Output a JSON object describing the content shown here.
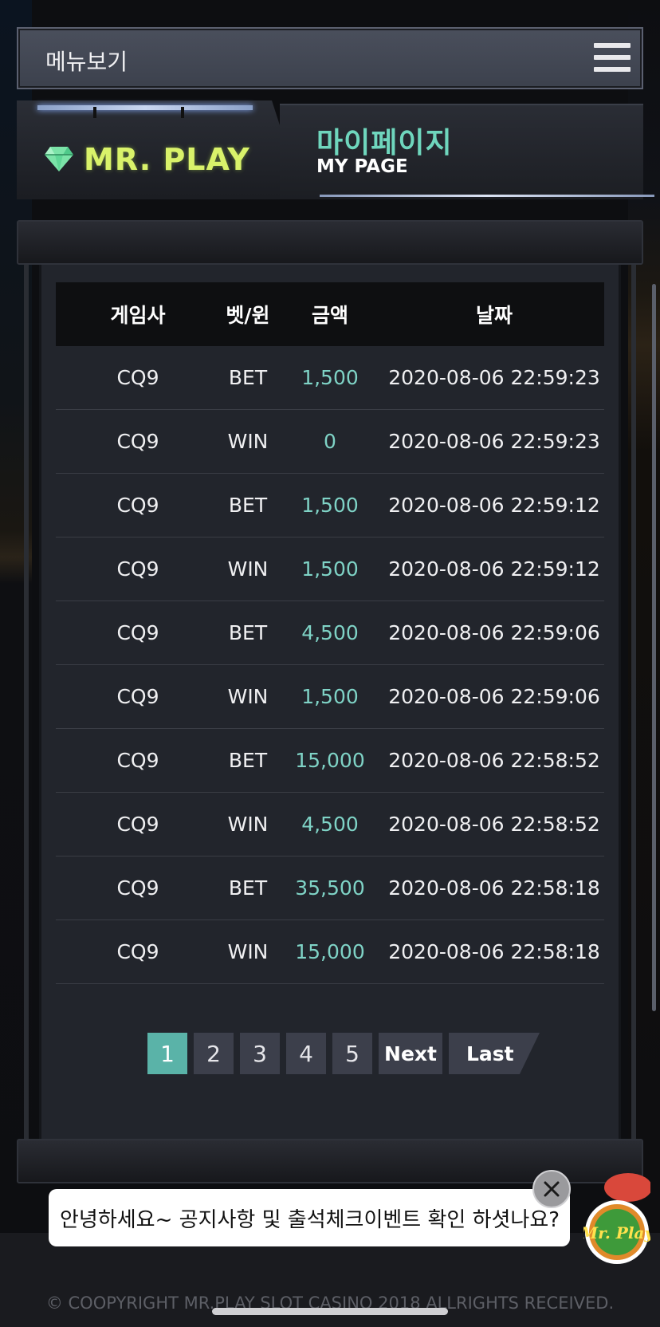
{
  "menu": {
    "label": "메뉴보기"
  },
  "banner": {
    "brand": "MR. PLAY",
    "page_title_kr": "마이페이지",
    "page_title_en": "MY PAGE"
  },
  "table": {
    "headers": [
      "게임사",
      "벳/윈",
      "금액",
      "날짜"
    ],
    "rows": [
      {
        "provider": "CQ9",
        "type": "BET",
        "amount": "1,500",
        "date": "2020-08-06 22:59:23"
      },
      {
        "provider": "CQ9",
        "type": "WIN",
        "amount": "0",
        "date": "2020-08-06 22:59:23"
      },
      {
        "provider": "CQ9",
        "type": "BET",
        "amount": "1,500",
        "date": "2020-08-06 22:59:12"
      },
      {
        "provider": "CQ9",
        "type": "WIN",
        "amount": "1,500",
        "date": "2020-08-06 22:59:12"
      },
      {
        "provider": "CQ9",
        "type": "BET",
        "amount": "4,500",
        "date": "2020-08-06 22:59:06"
      },
      {
        "provider": "CQ9",
        "type": "WIN",
        "amount": "1,500",
        "date": "2020-08-06 22:59:06"
      },
      {
        "provider": "CQ9",
        "type": "BET",
        "amount": "15,000",
        "date": "2020-08-06 22:58:52"
      },
      {
        "provider": "CQ9",
        "type": "WIN",
        "amount": "4,500",
        "date": "2020-08-06 22:58:52"
      },
      {
        "provider": "CQ9",
        "type": "BET",
        "amount": "35,500",
        "date": "2020-08-06 22:58:18"
      },
      {
        "provider": "CQ9",
        "type": "WIN",
        "amount": "15,000",
        "date": "2020-08-06 22:58:18"
      }
    ]
  },
  "pagination": {
    "pages": [
      "1",
      "2",
      "3",
      "4",
      "5"
    ],
    "current": "1",
    "next": "Next",
    "last": "Last"
  },
  "chat": {
    "message": "안녕하세요~ 공지사항 및 출석체크이벤트 확인 하셧나요?",
    "close_icon": "close-icon",
    "mascot_text": "Mr. Play"
  },
  "footer": {
    "copyright": "© COOPYRIGHT MR.PLAY SLOT CASINO 2018 ALLRIGHTS RECEIVED."
  },
  "colors": {
    "brand": "#d9f26a",
    "accent": "#6fd6bd",
    "amount": "#7fd3c6",
    "active_page": "#5ab3a8"
  }
}
